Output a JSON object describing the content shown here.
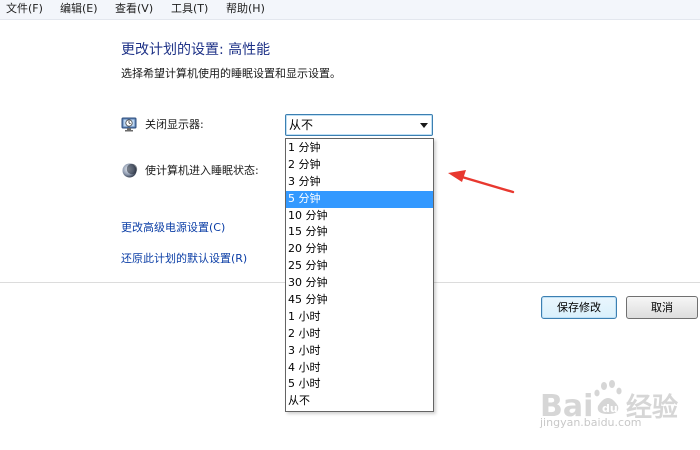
{
  "menu": {
    "items": [
      "文件(F)",
      "编辑(E)",
      "查看(V)",
      "工具(T)",
      "帮助(H)"
    ]
  },
  "page": {
    "title": "更改计划的设置: 高性能",
    "subtitle": "选择希望计算机使用的睡眠设置和显示设置。"
  },
  "settings": {
    "display_off_label": "关闭显示器:",
    "display_off_value": "从不",
    "sleep_label": "使计算机进入睡眠状态:"
  },
  "dropdown": {
    "options": [
      "1 分钟",
      "2 分钟",
      "3 分钟",
      "5 分钟",
      "10 分钟",
      "15 分钟",
      "20 分钟",
      "25 分钟",
      "30 分钟",
      "45 分钟",
      "1 小时",
      "2 小时",
      "3 小时",
      "4 小时",
      "5 小时",
      "从不"
    ],
    "highlighted": "5 分钟"
  },
  "links": {
    "advanced": "更改高级电源设置(C)",
    "restore": "还原此计划的默认设置(R)"
  },
  "buttons": {
    "save": "保存修改",
    "cancel": "取消"
  },
  "watermark": {
    "brand": "Bai度经验",
    "url": "jingyan.baidu.com"
  },
  "colors": {
    "highlight": "#3399ff",
    "title": "#1e3287",
    "link": "#0b3ea6",
    "annotation_arrow": "#e8382f"
  }
}
